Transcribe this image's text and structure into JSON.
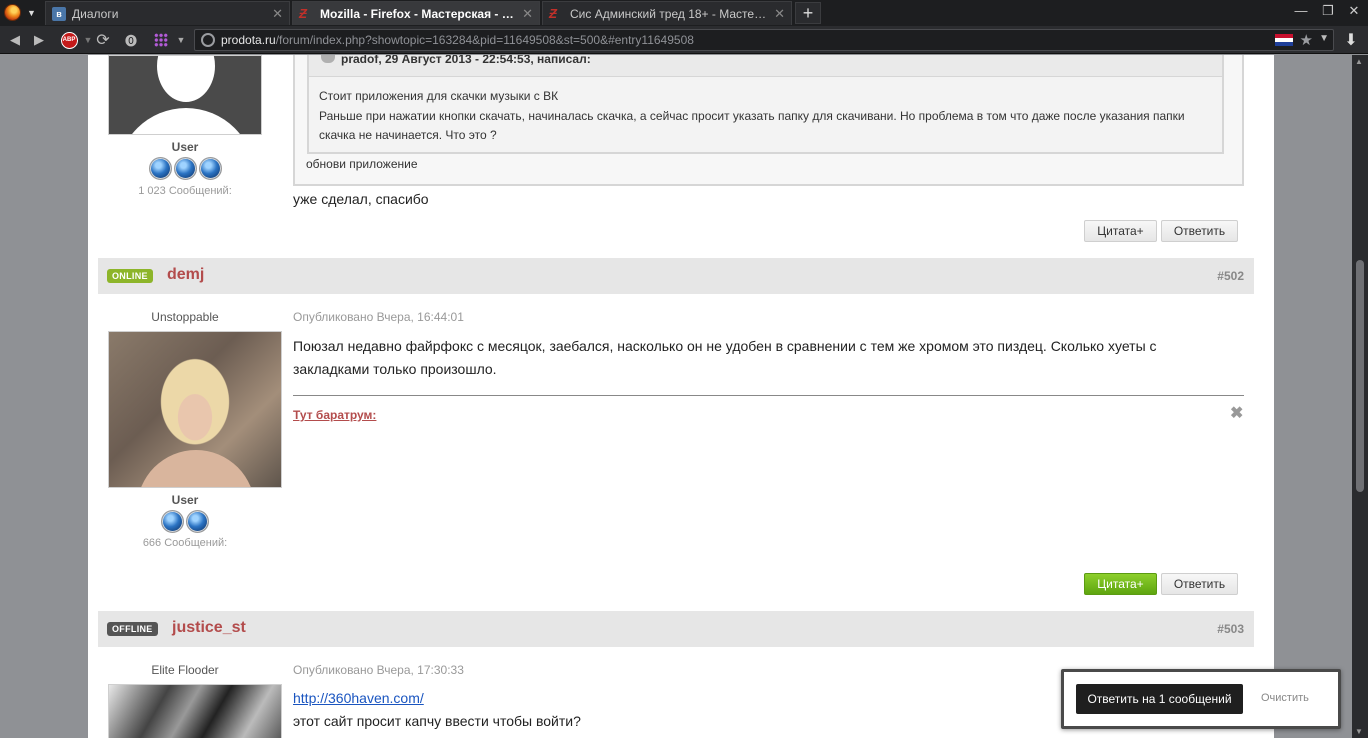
{
  "tabs": [
    {
      "label": "Диалоги",
      "icon": "vk-icon",
      "active": false
    },
    {
      "label": "Mozilla - Firefox - Мастерская - Pr...",
      "icon": "prodota-icon",
      "active": true
    },
    {
      "label": "Сис Админский тред 18+ - Мастер...",
      "icon": "prodota-icon",
      "active": false
    }
  ],
  "address": {
    "domain": "prodota.ru",
    "path": "/forum/index.php?showtopic=163284&pid=11649508&st=500&#entry11649508"
  },
  "post501": {
    "group": "User",
    "count": "1 023 Сообщений:",
    "quote_header": "pradof, 29 Август 2013 - 22:54:53, написал:",
    "quote_lines": [
      "Стоит приложения для скачки музыки с ВК",
      "Раньше при нажатии кнопки скачать, начиналась скачка, а сейчас просит указать папку для скачивани. Но проблема в том что даже после указания папки скачка не начинается. Что это ?"
    ],
    "quote_reply": "обнови приложение",
    "text": "уже сделал, спасибо"
  },
  "buttons": {
    "quote": "Цитата+",
    "reply": "Ответить"
  },
  "post502": {
    "status": "ONLINE",
    "author": "demj",
    "num": "#502",
    "rank": "Unstoppable",
    "group": "User",
    "count": "666 Сообщений:",
    "posted": "Опубликовано Вчера, 16:44:01",
    "text": "Поюзал недавно файрфокс с месяцок, заебался, насколько он не удобен в сравнении с тем же хромом это пиздец. Сколько хуеты с закладками только произошло.",
    "spoiler": "Тут баратрум:"
  },
  "post503": {
    "status": "OFFLINE",
    "author": "justice_st",
    "num": "#503",
    "rank": "Elite Flooder",
    "posted": "Опубликовано Вчера, 17:30:33",
    "link": "http://360haven.com/",
    "text": "этот сайт просит капчу ввести чтобы войти?"
  },
  "popup": {
    "reply": "Ответить на 1 сообщений",
    "clear": "Очистить"
  }
}
